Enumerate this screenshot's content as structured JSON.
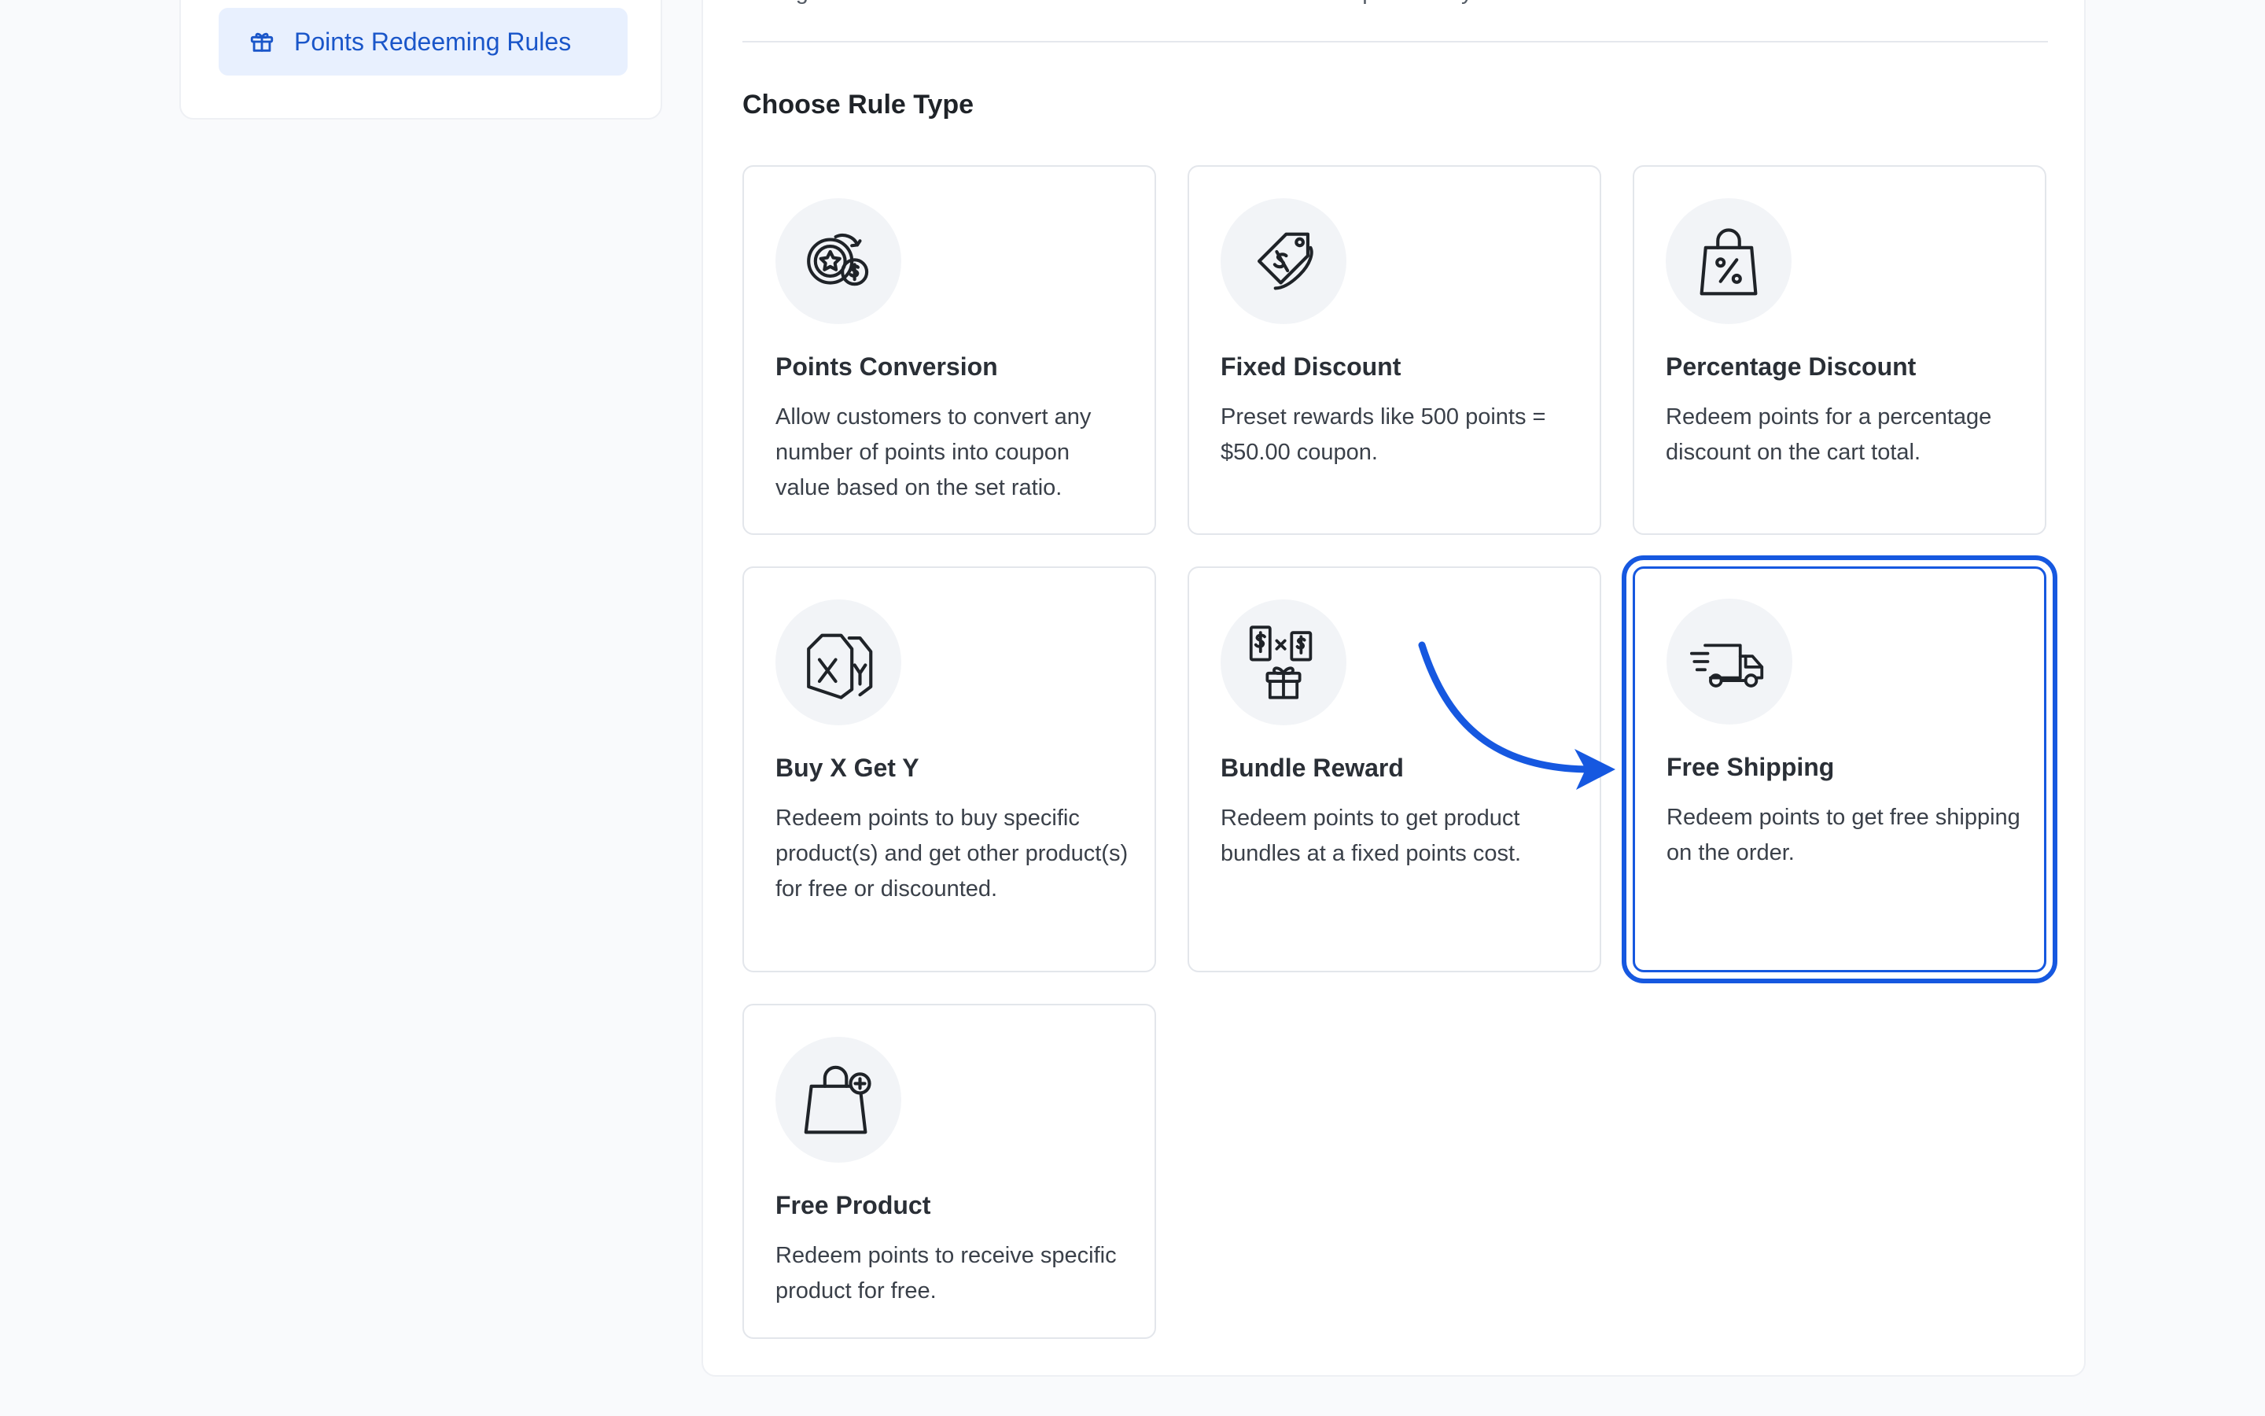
{
  "sidebar": {
    "active_item": {
      "label": "Points Redeeming Rules",
      "icon": "gift-icon"
    }
  },
  "main": {
    "description": "Configure the conditions under which customers can redeem points on your store.",
    "section_title": "Choose Rule Type",
    "accent_color": "#1658e0",
    "cards": [
      {
        "title": "Points Conversion",
        "body": "Allow customers to convert any number of points into coupon value based on the set ratio.",
        "icon": "points-conversion-icon",
        "selected": false
      },
      {
        "title": "Fixed Discount",
        "body": "Preset rewards like 500 points = $50.00 coupon.",
        "icon": "price-tag-icon",
        "selected": false
      },
      {
        "title": "Percentage Discount",
        "body": "Redeem points for a percentage discount on the cart total.",
        "icon": "percent-bag-icon",
        "selected": false
      },
      {
        "title": "Buy X Get Y",
        "body": "Redeem points to buy specific product(s) and get other product(s) for free or discounted.",
        "icon": "xy-tags-icon",
        "selected": false
      },
      {
        "title": "Bundle Reward",
        "body": "Redeem points to get product bundles at a fixed points cost.",
        "icon": "bundle-gift-icon",
        "selected": false
      },
      {
        "title": "Free Shipping",
        "body": "Redeem points to get free shipping on the order.",
        "icon": "delivery-truck-icon",
        "selected": true
      },
      {
        "title": "Free Product",
        "body": "Redeem points to receive specific product for free.",
        "icon": "bag-plus-icon",
        "selected": false
      }
    ]
  }
}
